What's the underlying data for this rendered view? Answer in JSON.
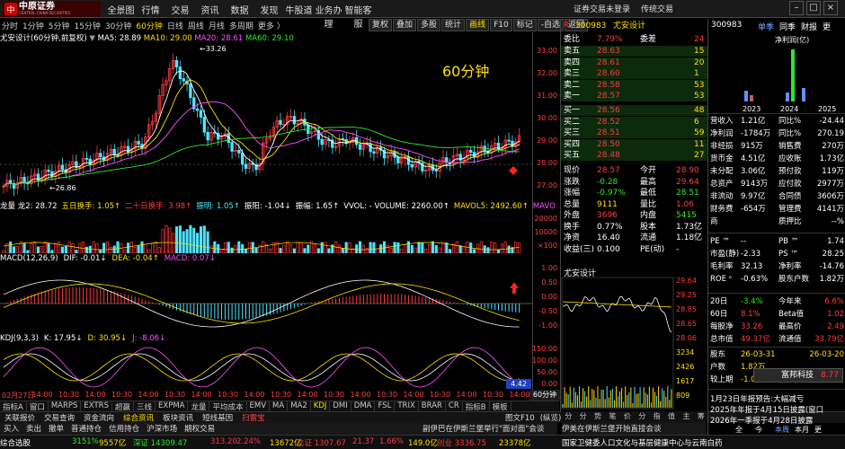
{
  "top": {
    "logo_name": "中原证券",
    "logo_sub": "CENTRAL CHINA SECURITIES",
    "menu": [
      "全景图",
      "行情",
      "交易",
      "资讯",
      "数据",
      "发现",
      "牛股道",
      "业务办理",
      "智能客服"
    ],
    "right": [
      "证券交易未登录",
      "传统交易"
    ]
  },
  "period": {
    "items": [
      "分时",
      "1分钟",
      "5分钟",
      "15分钟",
      "30分钟",
      "60分钟",
      "日线",
      "周线",
      "月线",
      "多周期",
      "更多 〉"
    ],
    "active": "60分钟"
  },
  "toolbar": {
    "items": [
      "复权",
      "叠加",
      "多股",
      "统计",
      "画线",
      "F10",
      "标记",
      "-自选",
      "返回"
    ],
    "active": "画线"
  },
  "kline": {
    "title": "尤安设计(60分钟,前复权)",
    "ma5": "MA5: 28.89",
    "ma10": "MA10: 29.00",
    "ma20": "MA20: 28.61",
    "ma60": "MA60: 29.10",
    "overlay": "60分钟",
    "high_label": "33.26",
    "low_label": "26.86",
    "axis": [
      "33.00",
      "32.00",
      "31.00",
      "30.00",
      "29.00",
      "28.00",
      "27.00"
    ],
    "ma_colors": {
      "ma5": "#ffffff",
      "ma10": "#ffe000",
      "ma20": "#ff4fff",
      "ma60": "#2ee82e"
    }
  },
  "vol": {
    "legend": [
      "龙量 龙2: 28.72",
      "五日换手: 1.05↑",
      "二十日换手: 3.98↑",
      "振明: 1.05↑",
      "振阳: -1.04↓",
      "振幅: 1.65↑",
      "VVOL: - VOLUME: 2260.00↑",
      "MAVOL5: 2492.60↑",
      "MAVO"
    ],
    "axis": [
      "20000",
      "10000",
      "×100"
    ]
  },
  "macd": {
    "legend": [
      "MACD(12,26,9)",
      "DIF: -0.01↓",
      "DEA: -0.04↑",
      "MACD: 0.07↓"
    ],
    "axis": [
      "1.00",
      "0.50",
      "0.00",
      "-0.50",
      "-1.00"
    ]
  },
  "kdj": {
    "legend": [
      "KDJ(9,3,3)",
      "K: 17.95↓",
      "D: 30.95↓",
      "J: -8.06↓"
    ],
    "axis": [
      "150.00",
      "100.00",
      "50.00",
      "0.00"
    ],
    "badge": "4.42"
  },
  "time": {
    "labels": [
      "02月27日",
      "14:00",
      "10:30",
      "14:00",
      "10:30",
      "14:00",
      "10:30",
      "14:00",
      "10:30",
      "14:00",
      "10:30",
      "14:00",
      "10:30",
      "14:00",
      "10:30",
      "14:00",
      "10:30",
      "14:00",
      "10:30",
      "14:00"
    ],
    "period": "60分钟"
  },
  "idx": {
    "items": [
      "指标A",
      "窗口",
      "MARPS",
      "EXTRS",
      "超赢",
      "三线",
      "EXPMA",
      "龙量",
      "平均成本",
      "EMV",
      "MA",
      "MA2",
      "KDJ",
      "DMI",
      "DMA",
      "FSL",
      "TRIX",
      "BRAR",
      "CR",
      "指标B",
      "模板"
    ]
  },
  "bottom": {
    "items": [
      "关联报价",
      "交易查询",
      "资金流向",
      "综合资讯",
      "板块资讯",
      "短线基因",
      "扫雷宝"
    ],
    "active": "综合资讯",
    "right": [
      "图文F10",
      "(纵览)"
    ]
  },
  "action": {
    "items": [
      "买入",
      "卖出",
      "撤单",
      "普通持仓",
      "信用持仓",
      "沪深市场",
      "期权交易"
    ],
    "ticker": "副伊巴在伊斯兰堡举行\"面对面\"会谈",
    "ticker2": "伊美在伊斯兰堡开始直接会谈"
  },
  "status": {
    "seg1": "综合选股",
    "seg2": "3151%",
    "seg3": "9557亿",
    "seg4": "深证 14309.47",
    "seg5": "313.20",
    "seg6": "2.24%",
    "seg7": "13672亿",
    "seg8": "北证 1307.67",
    "seg9": "21.37",
    "seg10": "1.66%",
    "seg11": "149.0亿",
    "seg12": "创业 3336.75",
    "seg13": "23378亿",
    "seg14": "国家卫健委人口文化与基层健康中心与云南白药"
  },
  "quote": {
    "code": "300983",
    "name": "尤安设计",
    "webi_label": "委比",
    "webi": "7.79%",
    "weicha_label": "委差",
    "weicha": "24",
    "sells": [
      {
        "l": "卖五",
        "p": "28.63",
        "v": "15"
      },
      {
        "l": "卖四",
        "p": "28.61",
        "v": "20"
      },
      {
        "l": "卖三",
        "p": "28.60",
        "v": "1"
      },
      {
        "l": "卖二",
        "p": "28.58",
        "v": "53"
      },
      {
        "l": "卖一",
        "p": "28.57",
        "v": "53"
      }
    ],
    "buys": [
      {
        "l": "买一",
        "p": "28.56",
        "v": "48"
      },
      {
        "l": "买二",
        "p": "28.52",
        "v": "6"
      },
      {
        "l": "买三",
        "p": "28.51",
        "v": "59"
      },
      {
        "l": "买四",
        "p": "28.50",
        "v": "11"
      },
      {
        "l": "买五",
        "p": "28.48",
        "v": "27"
      }
    ],
    "stats": [
      {
        "a": "现价",
        "av": "28.57",
        "ac": "red",
        "b": "今开",
        "bv": "28.90",
        "bc": "red"
      },
      {
        "a": "涨跌",
        "av": "-0.28",
        "ac": "grn",
        "b": "最高",
        "bv": "29.64",
        "bc": "red"
      },
      {
        "a": "涨幅",
        "av": "-0.97%",
        "ac": "grn",
        "b": "最低",
        "bv": "28.51",
        "bc": "grn"
      },
      {
        "a": "总量",
        "av": "9111",
        "ac": "yel",
        "b": "量比",
        "bv": "1.06",
        "bc": "red"
      },
      {
        "a": "外盘",
        "av": "3696",
        "ac": "red",
        "b": "内盘",
        "bv": "5415",
        "bc": "grn"
      },
      {
        "a": "换手",
        "av": "0.77%",
        "ac": "wht",
        "b": "股本",
        "bv": "1.73亿",
        "bc": "wht"
      },
      {
        "a": "净资",
        "av": "16.40",
        "ac": "wht",
        "b": "流通",
        "bv": "1.18亿",
        "bc": "wht"
      },
      {
        "a": "收益(三)",
        "av": "0.100",
        "ac": "wht",
        "b": "PE(动)",
        "bv": "-",
        "bc": "wht"
      }
    ]
  },
  "mini": {
    "title": "尤安设计",
    "axis": [
      "29.64",
      "29.25",
      "28.85",
      "28.65",
      "28.06",
      "3234",
      "2426",
      "1617",
      "809"
    ],
    "tabs": [
      "分",
      "分",
      "势",
      "笔",
      "价",
      "分",
      "指",
      "值",
      "主",
      "筹"
    ]
  },
  "rp": {
    "code": "300983",
    "tabs": [
      "单季",
      "同季",
      "财报",
      "更"
    ],
    "chart_label": "净利润(亿)",
    "years": [
      "2023",
      "2024",
      "2025"
    ],
    "rows": [
      {
        "a": "营收入",
        "av": "1.21亿",
        "b": "同比%",
        "bv": "-24.44"
      },
      {
        "a": "净利润",
        "av": "-1784万",
        "b": "同比%",
        "bv": "270.19"
      },
      {
        "a": "非经损",
        "av": "915万",
        "b": "销售费",
        "bv": "270万"
      },
      {
        "a": "货币金",
        "av": "4.51亿",
        "b": "应收账",
        "bv": "1.73亿"
      },
      {
        "a": "未分配",
        "av": "3.06亿",
        "b": "预付款",
        "bv": "119万"
      },
      {
        "a": "总资产",
        "av": "9143万",
        "b": "应付款",
        "bv": "2977万"
      },
      {
        "a": "非流动",
        "av": "9.97亿",
        "b": "合同债",
        "bv": "3606万"
      },
      {
        "a": "财务费",
        "av": "-654万",
        "b": "管理费",
        "bv": "4141万"
      },
      {
        "a": "商",
        "av": "",
        "b": "质押比",
        "bv": "--%"
      }
    ],
    "rows2": [
      {
        "a": "PE ™",
        "av": "--",
        "b": "PB ™",
        "bv": "1.74"
      },
      {
        "a": "市盈(静)",
        "av": "-2.33",
        "b": "PS ™",
        "bv": "28.25"
      },
      {
        "a": "毛利率",
        "av": "32.13",
        "b": "净利率",
        "bv": "-14.76"
      },
      {
        "a": "ROE ᵒ",
        "av": "-0.63%",
        "b": "股东户数",
        "bv": "1.82万"
      }
    ],
    "rows3": [
      {
        "a": "20日",
        "av": "-3.4%",
        "b": "今年来",
        "bv": "6.6%"
      },
      {
        "a": "60日",
        "av": "8.1%",
        "b": "Beta值",
        "bv": "1.02"
      },
      {
        "a": "每股净",
        "av": "33.26",
        "b": "最高价",
        "bv": "2.49"
      },
      {
        "a": "总市值",
        "av": "49.37亿",
        "b": "流通值",
        "bv": "33.79亿"
      }
    ],
    "rows4": [
      {
        "a": "股东",
        "av": "26-03-31",
        "b": "",
        "bv": "26-03-20"
      },
      {
        "a": "户数",
        "av": "1.82万",
        "b": "",
        "bv": ""
      },
      {
        "a": "较上期",
        "av": "-1.09%",
        "b": "",
        "bv": ""
      }
    ],
    "popup": {
      "name": "富邦科技",
      "val": "8.77"
    },
    "news": [
      "1月23日年报预告:大幅减亏",
      "2025年年报于4月15日披露(窗口",
      "2026年一季报于4月28日披露"
    ],
    "ntabs": [
      "全",
      "今",
      "本周",
      "本月",
      "更"
    ]
  }
}
